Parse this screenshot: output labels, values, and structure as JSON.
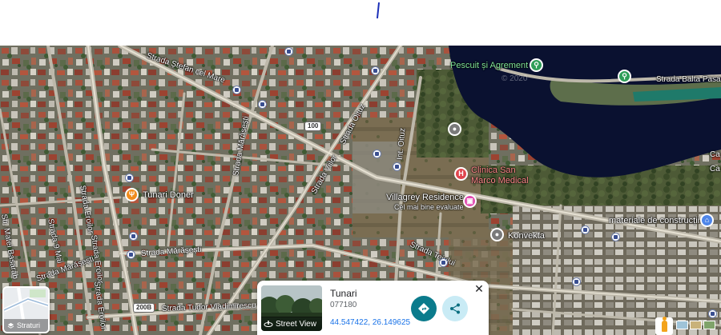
{
  "map": {
    "streets": [
      {
        "id": "stefan-cel-mare",
        "label": "Strada Ștefan cel Mare"
      },
      {
        "id": "balta-pasarii",
        "label": "Strada Balta Pasar"
      },
      {
        "id": "oituz",
        "label": "Strada Oituz"
      },
      {
        "id": "int-oituz",
        "label": "Int. Oituz"
      },
      {
        "id": "marasesti-v",
        "label": "Strada Mărășești"
      },
      {
        "id": "viilor",
        "label": "Strada Viilor"
      },
      {
        "id": "eroilor-1",
        "label": "Strada Eroilor"
      },
      {
        "id": "eroilor-2",
        "label": "Strada Eroilor"
      },
      {
        "id": "matei-basarab",
        "label": "Str. Matei Basarab"
      },
      {
        "id": "9-mai",
        "label": "Strada 9 Mai"
      },
      {
        "id": "marasesti-h",
        "label": "Strada Mărășești"
      },
      {
        "id": "marasesti-diag",
        "label": "Strada Mărășești"
      },
      {
        "id": "teiului",
        "label": "Strada Teiului"
      },
      {
        "id": "tudor-vladimirescu",
        "label": "Strada Tudor Vladimirescu"
      }
    ],
    "road_shields": [
      "100",
      "200B"
    ],
    "pois": [
      {
        "id": "pescuit",
        "label": "Pescuit și Agrement",
        "icon": "fishing-pin-icon",
        "color": "#2f9e59"
      },
      {
        "id": "clinica",
        "label": "Clinica San Marco Medical",
        "line1": "Clinica San",
        "line2": "Marco Medical",
        "icon": "hospital-pin-icon",
        "icon_glyph": "H",
        "color": "#e0464e"
      },
      {
        "id": "villagrey",
        "label": "Villagrey Residence",
        "sublabel": "Cel mai bine evaluate",
        "icon": "hotel-pin-icon",
        "color": "#e24bb1"
      },
      {
        "id": "tunari-doner",
        "label": "Tunari Doner",
        "icon": "food-pin-icon",
        "color": "#f08c1c"
      },
      {
        "id": "konvekta",
        "label": "Konvekta",
        "icon": "place-pin-icon",
        "color": "#7a7a7a"
      },
      {
        "id": "materiale",
        "label": "materiale de construcții",
        "icon": "store-pin-icon",
        "color": "#4f86e8"
      }
    ],
    "edge_labels": [
      "Ca",
      "Ca"
    ]
  },
  "place_card": {
    "title": "Tunari",
    "postal_code": "077180",
    "coordinates": "44.547422, 26.149625",
    "street_view_label": "Street View",
    "close_glyph": "✕"
  },
  "layers_button": {
    "label": "Straturi"
  },
  "colors": {
    "water": "#0a1130",
    "directions_button": "#0b7b8c",
    "share_button": "#c9ebf5",
    "link_blue": "#1a73e8"
  }
}
